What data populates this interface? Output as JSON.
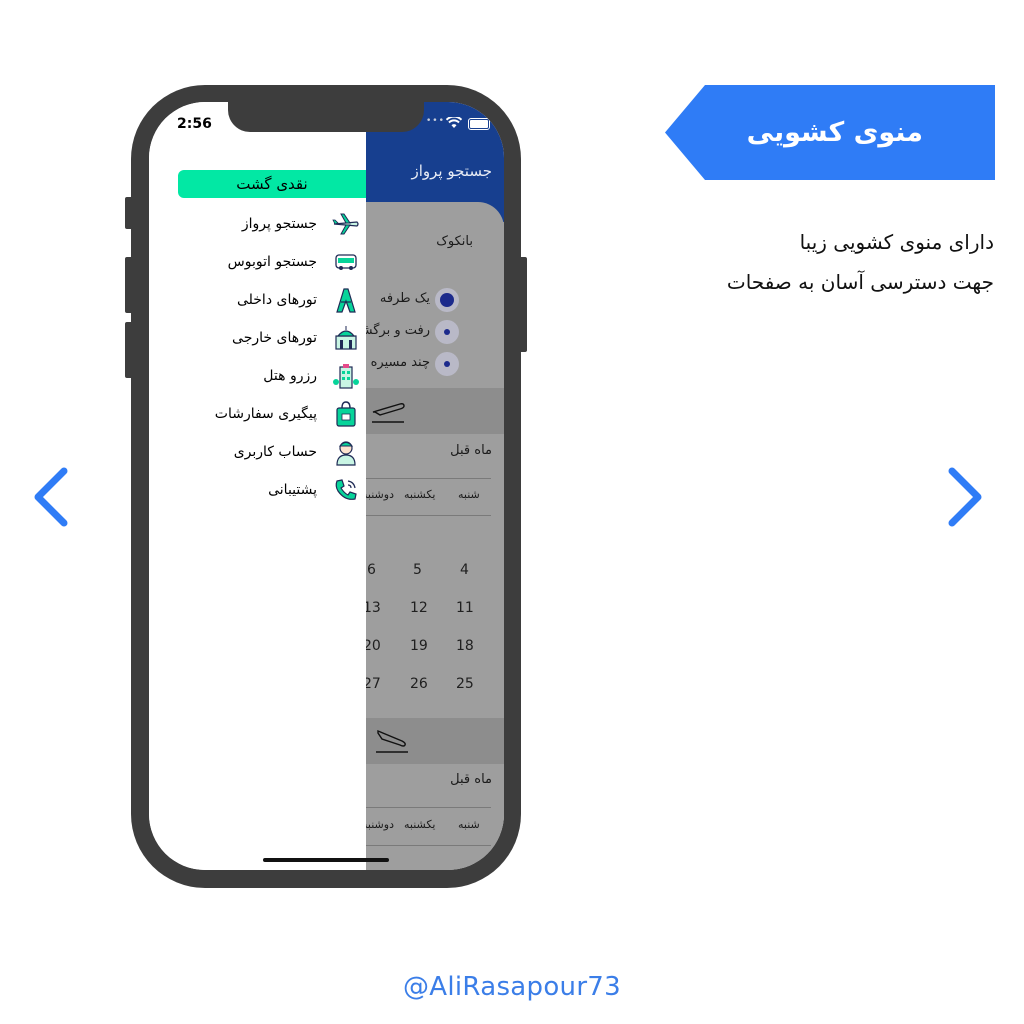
{
  "headline": {
    "title": "منوی کشویی",
    "lines": [
      "دارای منوی کشویی زیبا",
      "جهت دسترسی آسان به صفحات"
    ]
  },
  "credit": "@AliRasapour73",
  "colors": {
    "accent": "#2f7cf6",
    "drawer_button": "#02e8a4",
    "app_header": "#173f8f"
  },
  "navigation": {
    "prev_icon": "chevron-left-icon",
    "next_icon": "chevron-right-icon"
  },
  "phone": {
    "status_time": "2:56",
    "drawer": {
      "cash_button": "نقدی گشت",
      "items": [
        {
          "label": "جستجو پرواز",
          "icon": "airplane-icon"
        },
        {
          "label": "جستجو اتوبوس",
          "icon": "bus-icon"
        },
        {
          "label": "تورهای داخلی",
          "icon": "tower-icon"
        },
        {
          "label": "تورهای خارجی",
          "icon": "palace-icon"
        },
        {
          "label": "رزرو هتل",
          "icon": "hotel-icon"
        },
        {
          "label": "پیگیری سفارشات",
          "icon": "shopping-bag-icon"
        },
        {
          "label": "حساب کاربری",
          "icon": "user-icon"
        },
        {
          "label": "پشتیبانی",
          "icon": "phone-support-icon"
        }
      ]
    },
    "background_app": {
      "header_title": "جستجو پرواز",
      "city": "بانکوک",
      "trip_options": [
        "یک طرفه",
        "رفت و برگشت",
        "چند مسیره"
      ],
      "prev_month": "ماه قبل",
      "weekdays": [
        "شنبه",
        "یکشنبه",
        "دوشنبه"
      ],
      "calendar_rows": [
        [
          "4",
          "5",
          "6"
        ],
        [
          "11",
          "12",
          "13"
        ],
        [
          "18",
          "19",
          "20"
        ],
        [
          "25",
          "26",
          "27"
        ]
      ]
    }
  }
}
